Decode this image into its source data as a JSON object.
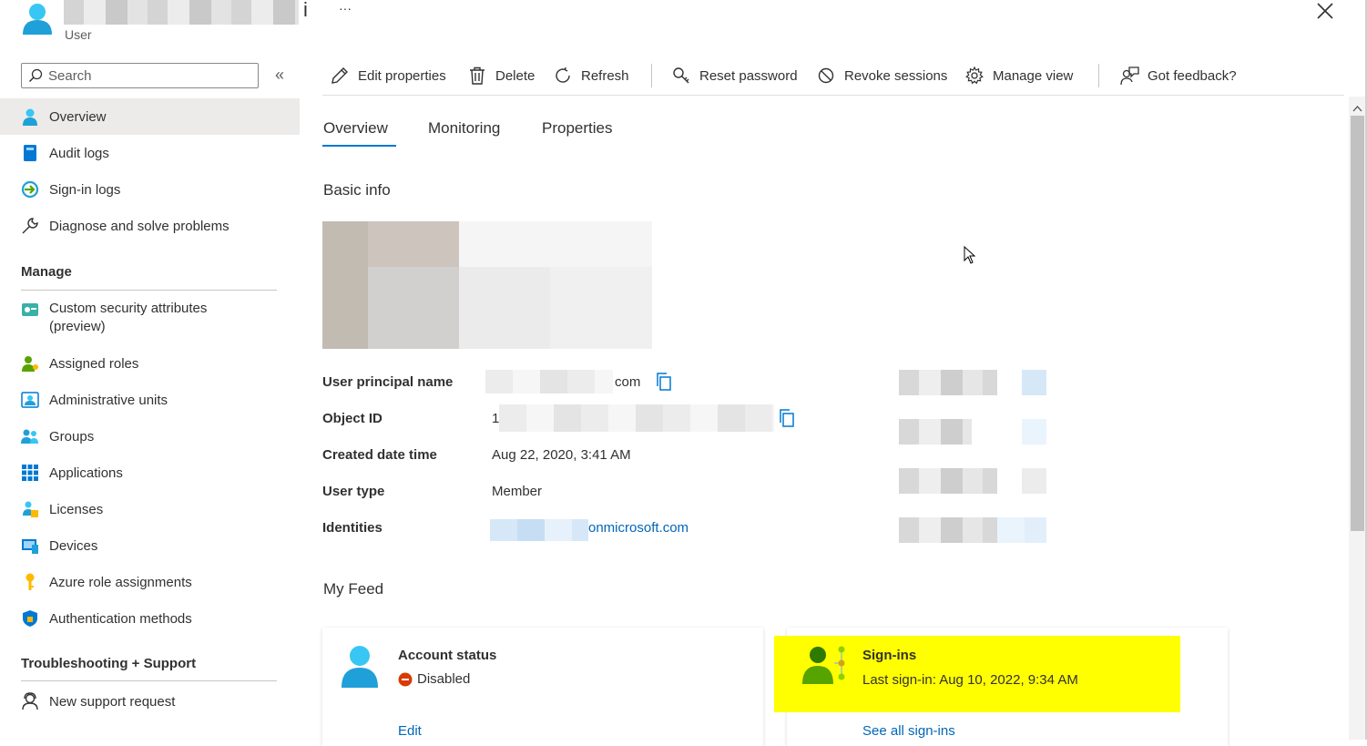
{
  "header": {
    "role_label": "User",
    "more_label": "···",
    "title_tail": "i"
  },
  "sidebar": {
    "search_placeholder": "Search",
    "collapse_label": "«",
    "items": [
      {
        "label": "Overview"
      },
      {
        "label": "Audit logs"
      },
      {
        "label": "Sign-in logs"
      },
      {
        "label": "Diagnose and solve problems"
      }
    ],
    "manage_heading": "Manage",
    "manage_items": [
      {
        "label": "Custom security attributes"
      },
      {
        "label": "(preview)"
      },
      {
        "label": "Assigned roles"
      },
      {
        "label": "Administrative units"
      },
      {
        "label": "Groups"
      },
      {
        "label": "Applications"
      },
      {
        "label": "Licenses"
      },
      {
        "label": "Devices"
      },
      {
        "label": "Azure role assignments"
      },
      {
        "label": "Authentication methods"
      }
    ],
    "support_heading": "Troubleshooting + Support",
    "support_items": [
      {
        "label": "New support request"
      }
    ]
  },
  "toolbar": {
    "edit": "Edit properties",
    "delete": "Delete",
    "refresh": "Refresh",
    "reset": "Reset password",
    "revoke": "Revoke sessions",
    "manage_view": "Manage view",
    "feedback": "Got feedback?"
  },
  "tabs": [
    "Overview",
    "Monitoring",
    "Properties"
  ],
  "basic_info": {
    "heading": "Basic info",
    "upn_label": "User principal name",
    "upn_suffix": "com",
    "objid_label": "Object ID",
    "objid_prefix": "1",
    "created_label": "Created date time",
    "created_value": "Aug 22, 2020, 3:41 AM",
    "usertype_label": "User type",
    "usertype_value": "Member",
    "identities_label": "Identities",
    "identities_suffix": "onmicrosoft.com"
  },
  "feed": {
    "heading": "My Feed",
    "account": {
      "title": "Account status",
      "status": "Disabled",
      "action": "Edit"
    },
    "signins": {
      "title": "Sign-ins",
      "last": "Last sign-in: Aug 10, 2022, 9:34 AM",
      "action": "See all sign-ins"
    }
  },
  "colors": {
    "accent": "#0078d4",
    "highlight": "#ffff00",
    "disabled": "#d83b01"
  }
}
